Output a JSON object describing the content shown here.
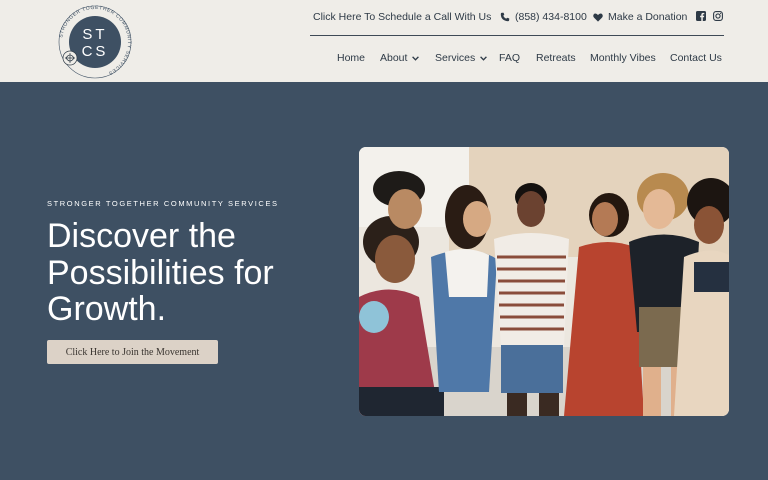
{
  "brand": {
    "ring_text": "STRONGER TOGETHER COMMUNITY SERVICES",
    "monogram_top": "ST",
    "monogram_bottom": "CS"
  },
  "topbar": {
    "schedule_label": "Click Here To Schedule a Call With Us",
    "phone": "(858) 434-8100",
    "donate_label": "Make a Donation",
    "social": [
      "facebook-icon",
      "instagram-icon"
    ]
  },
  "nav": {
    "items": [
      {
        "label": "Home",
        "dropdown": false
      },
      {
        "label": "About",
        "dropdown": true
      },
      {
        "label": "Services",
        "dropdown": true
      },
      {
        "label": "FAQ",
        "dropdown": false
      },
      {
        "label": "Retreats",
        "dropdown": false
      },
      {
        "label": "Monthly Vibes",
        "dropdown": false
      },
      {
        "label": "Contact Us",
        "dropdown": false
      }
    ]
  },
  "hero": {
    "eyebrow": "STRONGER TOGETHER COMMUNITY SERVICES",
    "title": "Discover the Possibilities for Growth.",
    "cta_label": "Click Here to Join the Movement",
    "image": "group-of-friends-laughing-photo"
  },
  "colors": {
    "header_bg": "#efede8",
    "hero_bg": "#3e5063",
    "logo_circle": "#3e5063",
    "cta_bg": "#dcd2c7",
    "text_dark": "#2e3a46"
  }
}
